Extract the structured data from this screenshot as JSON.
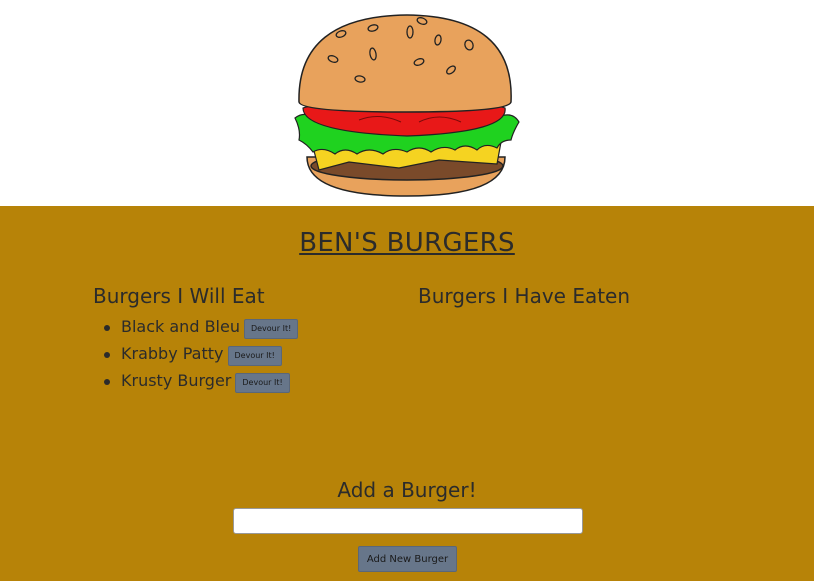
{
  "app": {
    "title": "BEN'S BURGERS"
  },
  "hero": {
    "image_icon": "burger-illustration"
  },
  "columns": {
    "to_eat_heading": "Burgers I Will Eat",
    "eaten_heading": "Burgers I Have Eaten"
  },
  "burgers_to_eat": [
    {
      "name": "Black and Bleu",
      "button_label": "Devour It!"
    },
    {
      "name": "Krabby Patty",
      "button_label": "Devour It!"
    },
    {
      "name": "Krusty Burger",
      "button_label": "Devour It!"
    }
  ],
  "burgers_eaten": [],
  "add_form": {
    "heading": "Add a Burger!",
    "input_value": "",
    "input_placeholder": "",
    "submit_label": "Add New Burger"
  },
  "colors": {
    "page_bg": "#b78308",
    "button_bg": "#67768a",
    "text": "#2b2b2b"
  }
}
